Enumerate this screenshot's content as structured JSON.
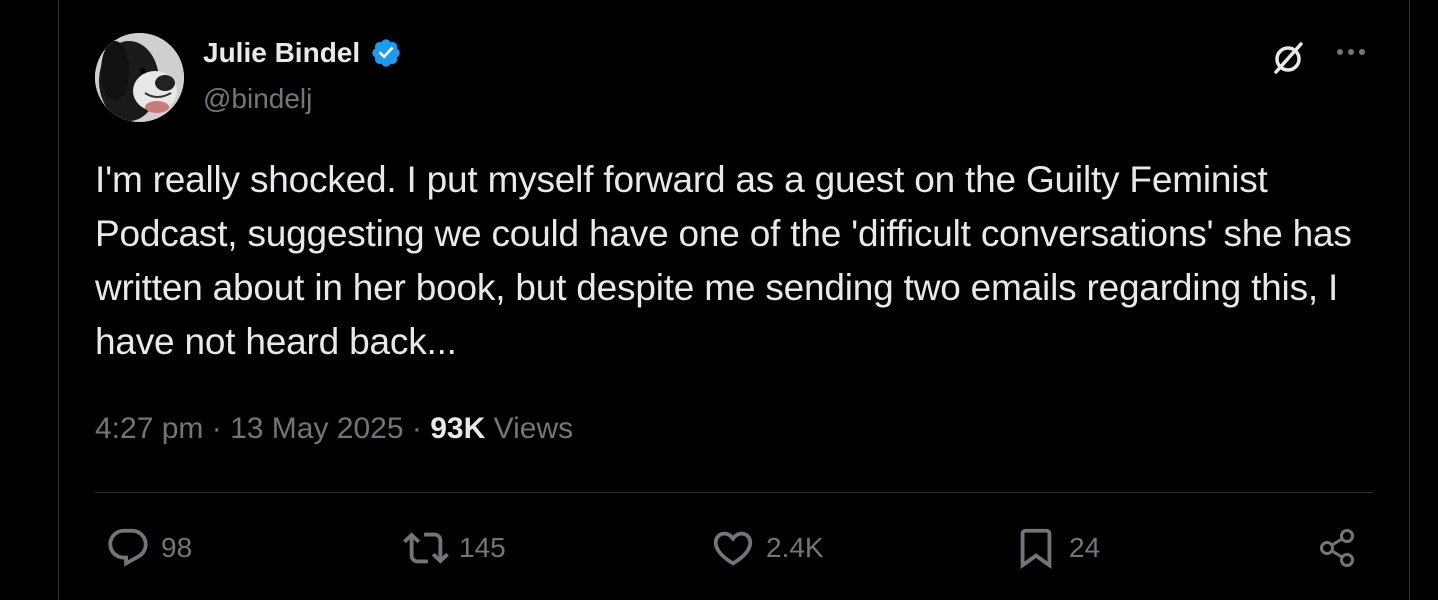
{
  "author": {
    "display_name": "Julie Bindel",
    "handle": "@bindelj",
    "verified": true
  },
  "tweet": {
    "text": "I'm really shocked. I put myself forward as a guest on the Guilty Feminist Podcast, suggesting we could have one of the 'difficult conversations' she has written about in her book, but despite me sending two emails regarding this, I have not heard back...",
    "time": "4:27 pm",
    "date": "13 May 2025",
    "separator": "·",
    "views_count": "93K",
    "views_label": "Views"
  },
  "actions": {
    "replies": "98",
    "reposts": "145",
    "likes": "2.4K",
    "bookmarks": "24"
  },
  "icons": {
    "grok": "grok-icon",
    "more": "more-icon",
    "reply": "reply-icon",
    "repost": "repost-icon",
    "like": "like-icon",
    "bookmark": "bookmark-icon",
    "share": "share-icon",
    "verified": "verified-badge-icon"
  },
  "colors": {
    "background": "#000000",
    "text_primary": "#e7e9ea",
    "text_secondary": "#71767b",
    "verified_blue": "#1d9bf0",
    "divider": "#2f3336"
  }
}
